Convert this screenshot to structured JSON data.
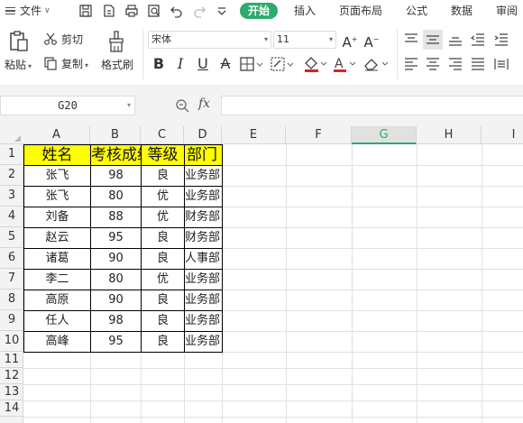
{
  "menu": {
    "file_label": "文件",
    "tabs": [
      {
        "label": "开始",
        "active": true
      },
      {
        "label": "插入",
        "active": false
      },
      {
        "label": "页面布局",
        "active": false
      },
      {
        "label": "公式",
        "active": false
      },
      {
        "label": "数据",
        "active": false
      },
      {
        "label": "审阅",
        "active": false
      }
    ]
  },
  "ribbon": {
    "paste_label": "粘贴",
    "cut_label": "剪切",
    "copy_label": "复制",
    "format_painter_label": "格式刷",
    "font_name": "宋体",
    "font_size": "11"
  },
  "formula_bar": {
    "name_box": "G20",
    "fx_label": "fx",
    "formula": ""
  },
  "grid": {
    "columns": [
      "A",
      "B",
      "C",
      "D",
      "E",
      "F",
      "G",
      "H",
      "I"
    ],
    "selected_column": "G",
    "row_numbers": [
      "1",
      "2",
      "3",
      "4",
      "5",
      "6",
      "7",
      "8",
      "9",
      "10",
      "11",
      "12",
      "13",
      "14"
    ],
    "header_row": [
      "姓名",
      "考核成绩",
      "等级",
      "部门"
    ],
    "rows": [
      [
        "张飞",
        "98",
        "良",
        "业务部"
      ],
      [
        "张飞",
        "80",
        "优",
        "业务部"
      ],
      [
        "刘备",
        "88",
        "优",
        "财务部"
      ],
      [
        "赵云",
        "95",
        "良",
        "财务部"
      ],
      [
        "诸葛",
        "90",
        "良",
        "人事部"
      ],
      [
        "李二",
        "80",
        "优",
        "业务部"
      ],
      [
        "高原",
        "90",
        "良",
        "业务部"
      ],
      [
        "任人",
        "98",
        "良",
        "业务部"
      ],
      [
        "高峰",
        "95",
        "良",
        "业务部"
      ]
    ]
  },
  "colors": {
    "accent": "#2cab6c",
    "header_fill": "#ffff00"
  }
}
